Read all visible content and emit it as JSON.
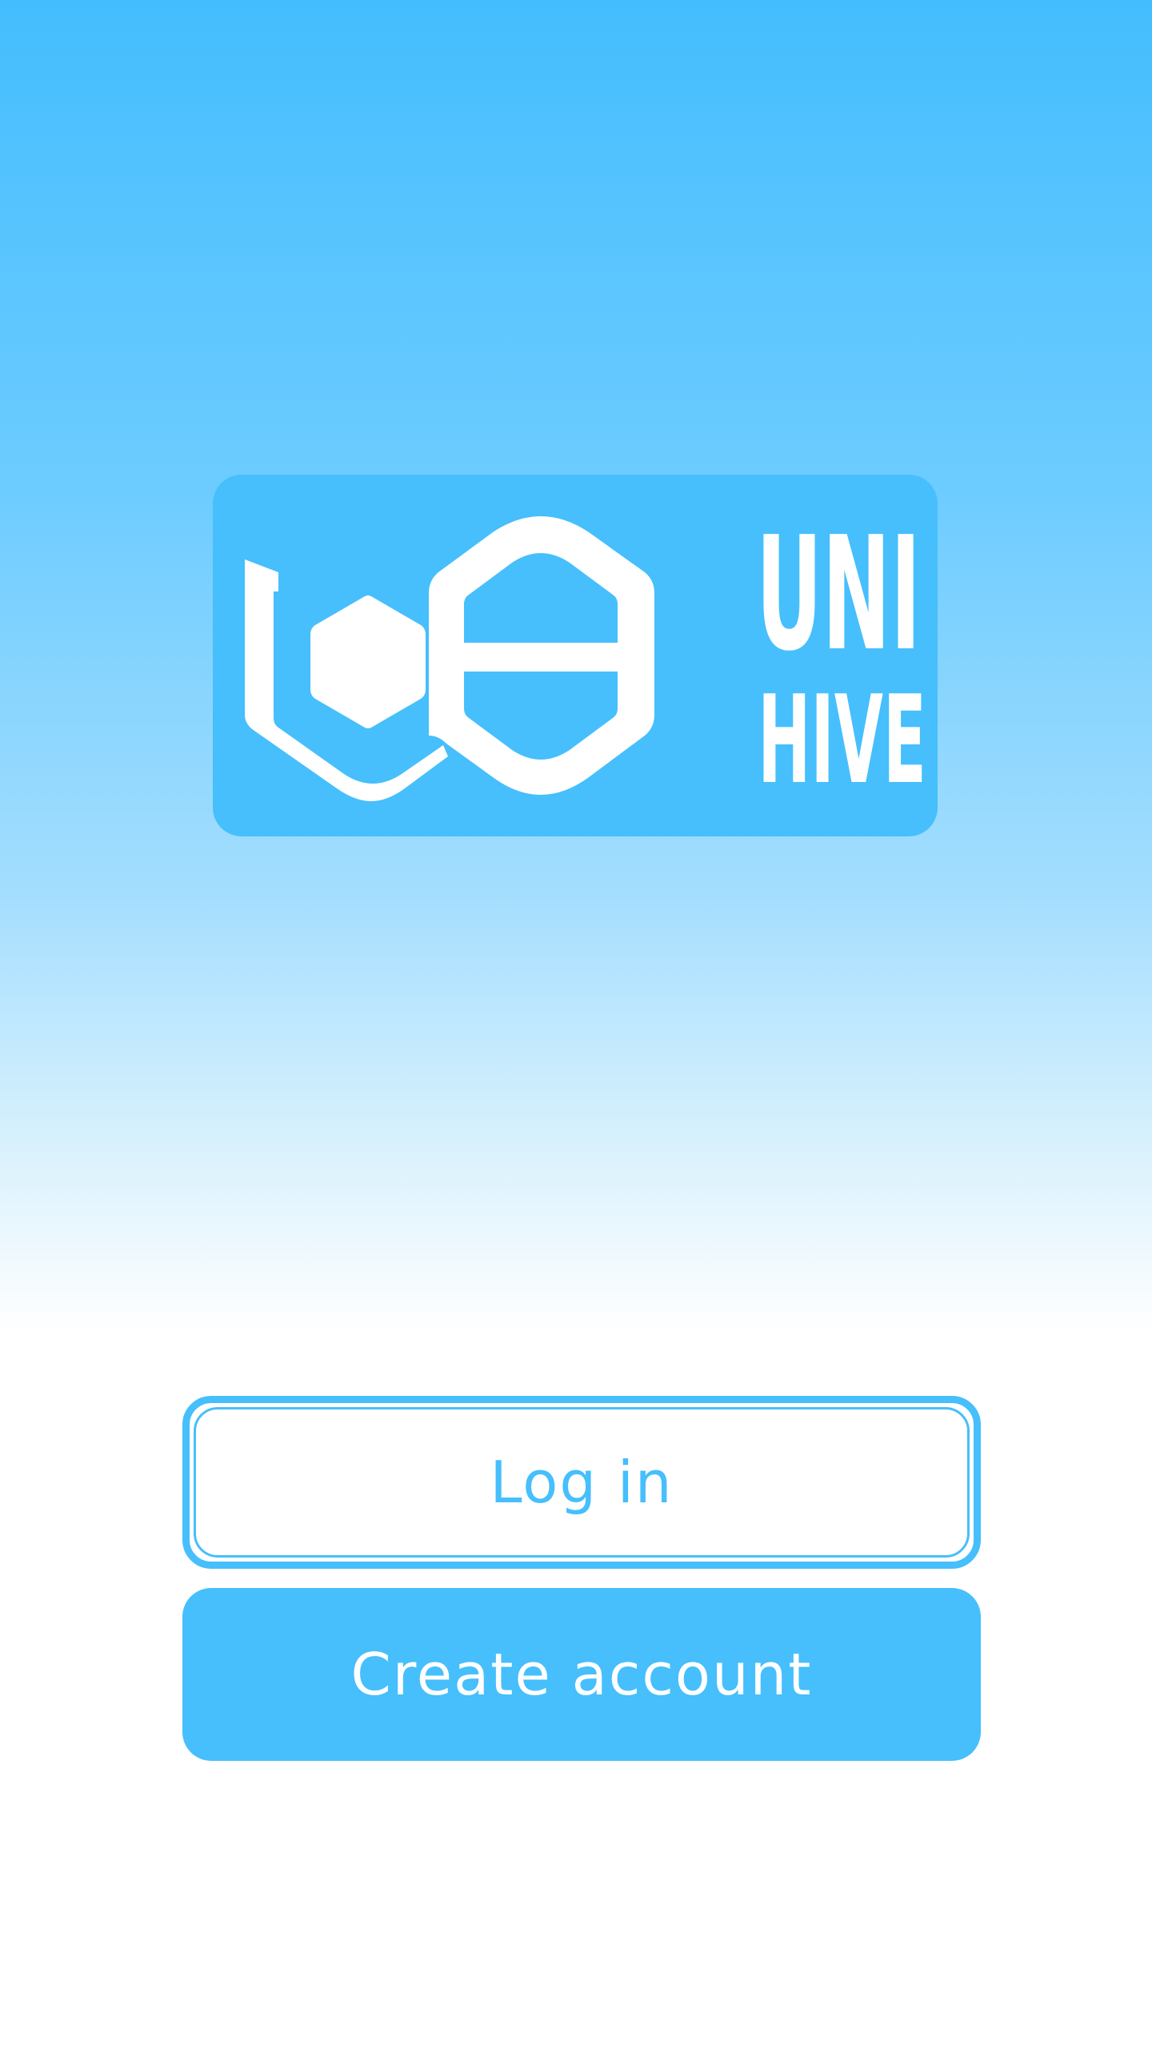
{
  "logo": {
    "icon": "hexagon-honeycomb-logo-icon",
    "word_top": "UNI",
    "word_bottom": "HIVE",
    "background_color": "#46bffc",
    "foreground_color": "#ffffff"
  },
  "actions": {
    "login_label": "Log in",
    "create_account_label": "Create account"
  },
  "colors": {
    "accent": "#46bffc",
    "gradient_top": "#44bdfe",
    "background_bottom": "#ffffff"
  }
}
